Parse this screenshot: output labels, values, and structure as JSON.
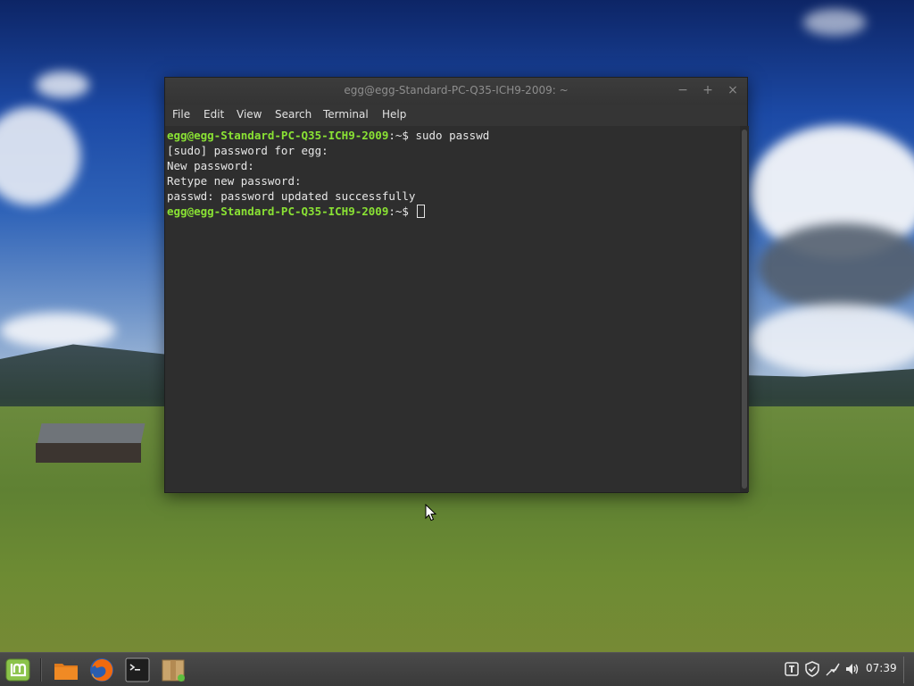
{
  "window": {
    "title": "egg@egg-Standard-PC-Q35-ICH9-2009: ~",
    "minimize_glyph": "−",
    "maximize_glyph": "+",
    "close_glyph": "×"
  },
  "menu": {
    "file": "File",
    "edit": "Edit",
    "view": "View",
    "search": "Search",
    "terminal": "Terminal",
    "help": "Help"
  },
  "terminal": {
    "prompt_user": "egg@egg-Standard-PC-Q35-ICH9-2009",
    "prompt_suffix": ":~$",
    "lines": {
      "cmd": " sudo passwd",
      "l2": "[sudo] password for egg:",
      "l3": "New password:",
      "l4": "Retype new password:",
      "l5": "passwd: password updated successfully"
    }
  },
  "taskbar": {
    "launchers": [
      "mint-menu-icon",
      "files-icon",
      "firefox-icon",
      "terminal-icon",
      "package-manager-icon"
    ],
    "tray_icons": [
      "keyboard-layout-icon",
      "update-shield-icon",
      "network-icon",
      "volume-icon"
    ],
    "clock": "07:39"
  },
  "colors": {
    "prompt_green": "#8ae234",
    "terminal_bg": "#2e2e2e",
    "titlebar_text": "#8e8e8e",
    "mint_green": "#8bc34a"
  }
}
